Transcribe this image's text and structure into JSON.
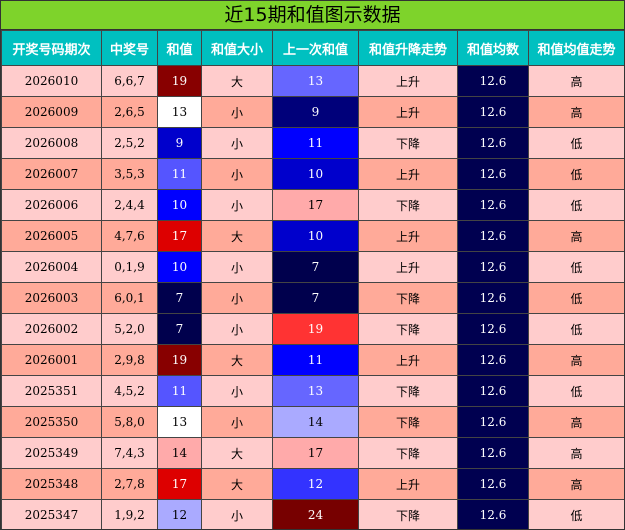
{
  "title": "近15期和值图示数据",
  "columns": [
    "开奖号码期次",
    "中奖号",
    "和值",
    "和值大小",
    "上一次和值",
    "和值升降走势",
    "和值均数",
    "和值均值走势"
  ],
  "sum_colors": {
    "7": "#00004d",
    "9": "#0000cc",
    "10": "#0000ff",
    "11": "#5555ff",
    "12": "#aaaaff",
    "13": "#ffffff",
    "14": "#ffaaaa",
    "17": "#dd0000",
    "19": "#880000",
    "24": "#770000"
  },
  "prev_colors": {
    "7": "#00004d",
    "9": "#00007a",
    "10": "#0000cc",
    "11": "#0000ff",
    "12": "#3333ff",
    "13": "#6666ff",
    "14": "#aaaaff",
    "17": "#ffaaaa",
    "19": "#ff3333",
    "24": "#770000"
  },
  "rows": [
    {
      "period": "2026010",
      "numbers": "6,6,7",
      "sum": "19",
      "size": "大",
      "prev": "13",
      "trend": "上升",
      "avg": "12.6",
      "avg_trend": "高"
    },
    {
      "period": "2026009",
      "numbers": "2,6,5",
      "sum": "13",
      "size": "小",
      "prev": "9",
      "trend": "上升",
      "avg": "12.6",
      "avg_trend": "高"
    },
    {
      "period": "2026008",
      "numbers": "2,5,2",
      "sum": "9",
      "size": "小",
      "prev": "11",
      "trend": "下降",
      "avg": "12.6",
      "avg_trend": "低"
    },
    {
      "period": "2026007",
      "numbers": "3,5,3",
      "sum": "11",
      "size": "小",
      "prev": "10",
      "trend": "上升",
      "avg": "12.6",
      "avg_trend": "低"
    },
    {
      "period": "2026006",
      "numbers": "2,4,4",
      "sum": "10",
      "size": "小",
      "prev": "17",
      "trend": "下降",
      "avg": "12.6",
      "avg_trend": "低"
    },
    {
      "period": "2026005",
      "numbers": "4,7,6",
      "sum": "17",
      "size": "大",
      "prev": "10",
      "trend": "上升",
      "avg": "12.6",
      "avg_trend": "高"
    },
    {
      "period": "2026004",
      "numbers": "0,1,9",
      "sum": "10",
      "size": "小",
      "prev": "7",
      "trend": "上升",
      "avg": "12.6",
      "avg_trend": "低"
    },
    {
      "period": "2026003",
      "numbers": "6,0,1",
      "sum": "7",
      "size": "小",
      "prev": "7",
      "trend": "下降",
      "avg": "12.6",
      "avg_trend": "低"
    },
    {
      "period": "2026002",
      "numbers": "5,2,0",
      "sum": "7",
      "size": "小",
      "prev": "19",
      "trend": "下降",
      "avg": "12.6",
      "avg_trend": "低"
    },
    {
      "period": "2026001",
      "numbers": "2,9,8",
      "sum": "19",
      "size": "大",
      "prev": "11",
      "trend": "上升",
      "avg": "12.6",
      "avg_trend": "高"
    },
    {
      "period": "2025351",
      "numbers": "4,5,2",
      "sum": "11",
      "size": "小",
      "prev": "13",
      "trend": "下降",
      "avg": "12.6",
      "avg_trend": "低"
    },
    {
      "period": "2025350",
      "numbers": "5,8,0",
      "sum": "13",
      "size": "小",
      "prev": "14",
      "trend": "下降",
      "avg": "12.6",
      "avg_trend": "高"
    },
    {
      "period": "2025349",
      "numbers": "7,4,3",
      "sum": "14",
      "size": "大",
      "prev": "17",
      "trend": "下降",
      "avg": "12.6",
      "avg_trend": "高"
    },
    {
      "period": "2025348",
      "numbers": "2,7,8",
      "sum": "17",
      "size": "大",
      "prev": "12",
      "trend": "上升",
      "avg": "12.6",
      "avg_trend": "高"
    },
    {
      "period": "2025347",
      "numbers": "1,9,2",
      "sum": "12",
      "size": "小",
      "prev": "24",
      "trend": "下降",
      "avg": "12.6",
      "avg_trend": "低"
    }
  ]
}
